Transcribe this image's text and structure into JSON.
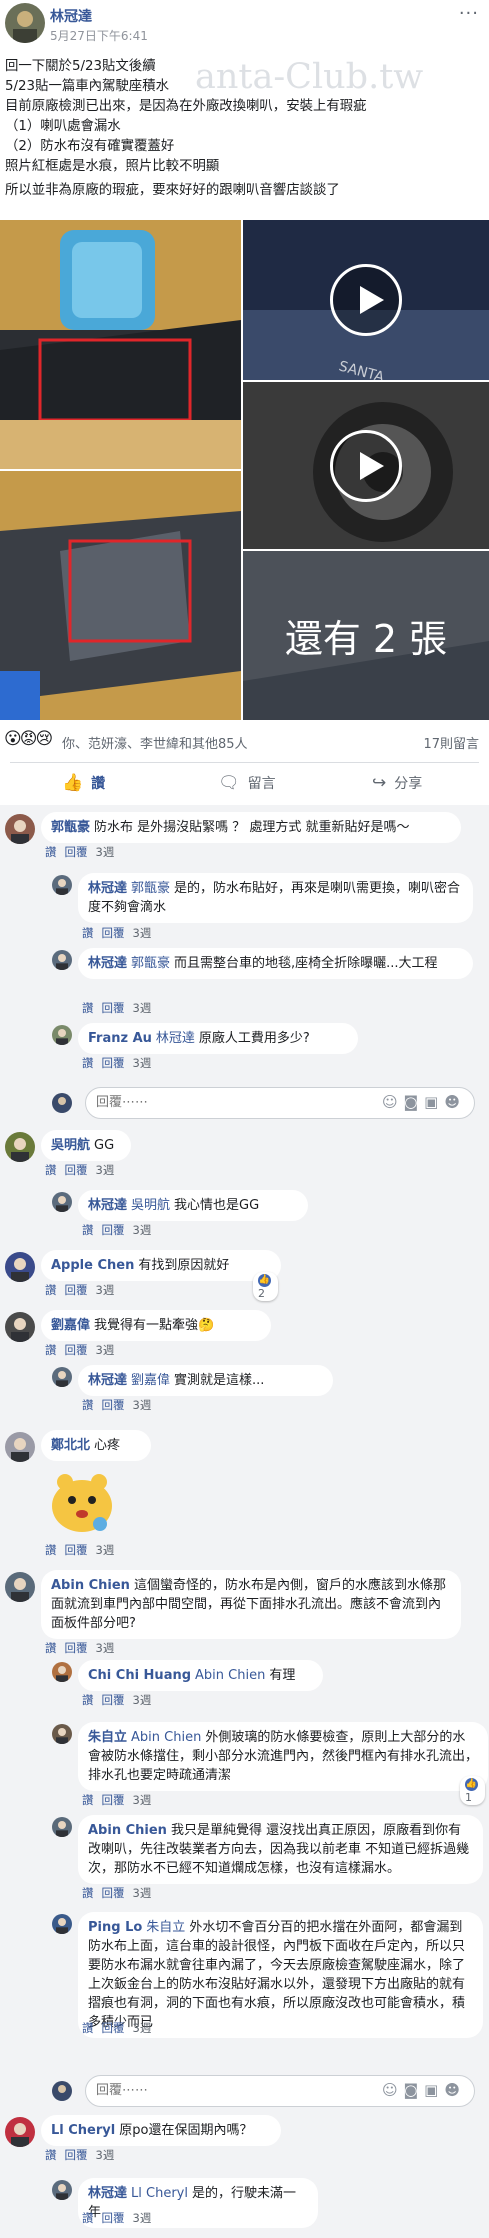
{
  "post": {
    "author": "林冠達",
    "time": "5月27日下午6:41",
    "more": "···",
    "watermark": "anta-Club.tw",
    "lines": [
      "回一下關於5/23貼文後續",
      "5/23貼一篇車內駕駛座積水",
      "目前原廠檢測已出來，是因為在外廠改換喇叭，安裝上有瑕疵",
      "（1）喇叭處會漏水",
      "（2）防水布沒有確實覆蓋好",
      "照片紅框處是水痕，照片比較不明顯",
      "所以並非為原廠的瑕疵，要來好好的跟喇叭音響店談談了"
    ],
    "more_photos": "還有 2 張",
    "reaction_icons": "😮😡😢",
    "reaction_text": "你、范妍濠、李世緯和其他85人",
    "comments_count": "17則留言"
  },
  "actions": {
    "like": "讚",
    "comment": "留言",
    "share": "分享"
  },
  "meta_labels": {
    "like": "讚",
    "reply": "回覆",
    "time3": "3週"
  },
  "reply_placeholder": "回覆⋯⋯",
  "comments": [
    {
      "name": "郭甑豪",
      "text": "防水布 是外揚沒貼緊嗎 ？ 處理方式 就重新貼好是嗎～"
    },
    {
      "name": "林冠達",
      "tag": "郭甑豪",
      "text": "是的，防水布貼好，再來是喇叭需更換，喇叭密合度不夠會滴水"
    },
    {
      "name": "林冠達",
      "tag": "郭甑豪",
      "text": "而且需整台車的地毯,座椅全折除曝曬...大工程"
    },
    {
      "name": "Franz Au",
      "tag": "林冠達",
      "text": "原廠人工費用多少?"
    },
    {
      "name": "吳明航",
      "text": "GG"
    },
    {
      "name": "林冠達",
      "tag": "吳明航",
      "text": "我心情也是GG"
    },
    {
      "name": "Apple Chen",
      "text": "有找到原因就好",
      "badge": "2"
    },
    {
      "name": "劉嘉偉",
      "text": "我覺得有一點牽強🤔"
    },
    {
      "name": "林冠達",
      "tag": "劉嘉偉",
      "text": "實測就是這樣..."
    },
    {
      "name": "鄭北北",
      "text": "心疼"
    },
    {
      "name": "Abin Chien",
      "text": "這個蠻奇怪的，防水布是內側，窗戶的水應該到水條那面就流到車門內部中間空間，再從下面排水孔流出。應該不會流到內面板件部分吧?"
    },
    {
      "name": "Chi Chi Huang",
      "tag": "Abin Chien",
      "text": "有理"
    },
    {
      "name": "朱自立",
      "tag": "Abin Chien",
      "text": "外側玻璃的防水條要檢查，原則上大部分的水會被防水條擋住，剩小部分水流進門內，然後門框內有排水孔流出，排水孔也要定時疏通清潔",
      "badge": "1"
    },
    {
      "name": "Abin Chien",
      "text": "我只是單純覺得 還沒找出真正原因，原廠看到你有改喇叭，先往改裝業者方向去，因為我以前老車 不知道已經拆過幾次，那防水不已經不知道爛成怎樣，也沒有這樣漏水。"
    },
    {
      "name": "Ping Lo",
      "tag": "朱自立",
      "text": "外水切不會百分百的把水擋在外面阿，都會漏到防水布上面，這台車的設計很怪，內門板下面收在戶定內，所以只要防水布漏水就會往車內漏了，今天去原廠檢查駕駛座漏水，除了上次鈑金台上的防水布沒貼好漏水以外，還發現下方出廠貼的就有摺痕也有洞，洞的下面也有水痕，所以原廠沒改也可能會積水，積多積少而已"
    },
    {
      "name": "Ll Cheryl",
      "text": "原po還在保固期內嗎？"
    },
    {
      "name": "林冠達",
      "tag": "Ll Cheryl",
      "text": "是的，行駛未滿一年"
    }
  ],
  "colors": {
    "link": "#385898",
    "bubble": "#ffffff",
    "comments_bg": "#f2f3f5",
    "like_blue": "#4267b2"
  }
}
